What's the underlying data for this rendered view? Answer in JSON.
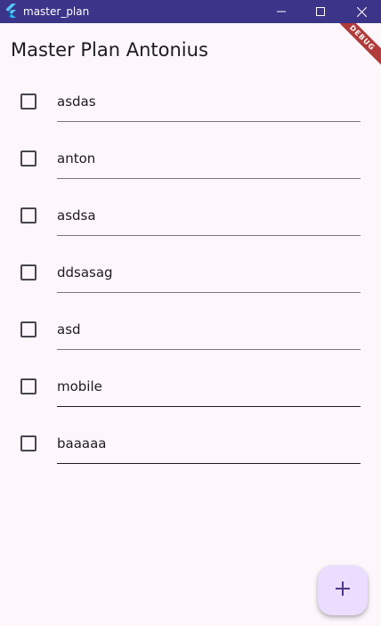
{
  "window": {
    "title": "master_plan",
    "app_icon": "flutter-logo-icon",
    "controls": [
      "minimize-icon",
      "maximize-icon",
      "close-icon"
    ]
  },
  "debug_banner": "DEBUG",
  "app_bar": {
    "title": "Master Plan Antonius"
  },
  "tasks": [
    {
      "description": "asdas",
      "complete": false
    },
    {
      "description": "anton",
      "complete": false
    },
    {
      "description": "asdsa",
      "complete": false
    },
    {
      "description": "ddsasag",
      "complete": false
    },
    {
      "description": "asd",
      "complete": false
    },
    {
      "description": "mobile",
      "complete": false
    },
    {
      "description": "baaaaa",
      "complete": false
    }
  ],
  "fab": {
    "icon": "plus-icon"
  },
  "colors": {
    "titlebar": "#3b3488",
    "background": "#fdf7fc",
    "fab": "#eaddff",
    "fab_icon": "#4f378b",
    "debug_ribbon": "#b13b3b"
  }
}
